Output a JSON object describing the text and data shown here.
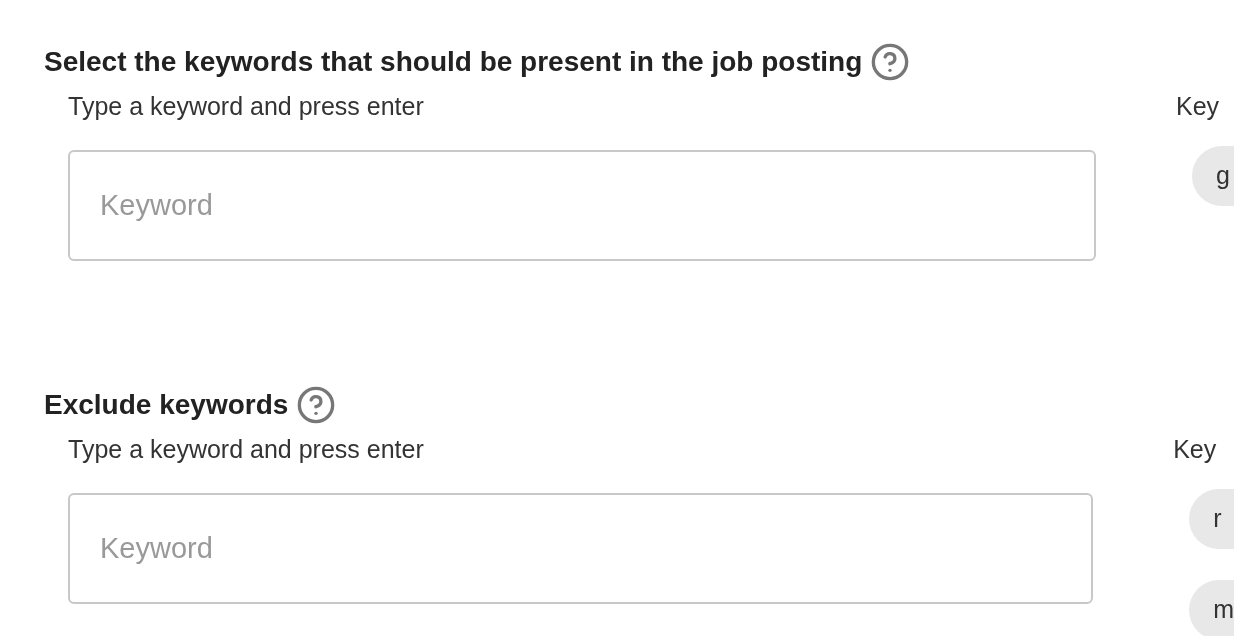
{
  "sections": [
    {
      "title": "Select the keywords that should be present in the job posting",
      "hint": "Type a keyword and press enter",
      "input": {
        "placeholder": "Keyword"
      },
      "list_label": "Key",
      "chips": [
        "g"
      ]
    },
    {
      "title": "Exclude keywords",
      "hint": "Type a keyword and press enter",
      "input": {
        "placeholder": "Keyword"
      },
      "list_label": "Key",
      "chips": [
        "r",
        "m"
      ]
    }
  ]
}
